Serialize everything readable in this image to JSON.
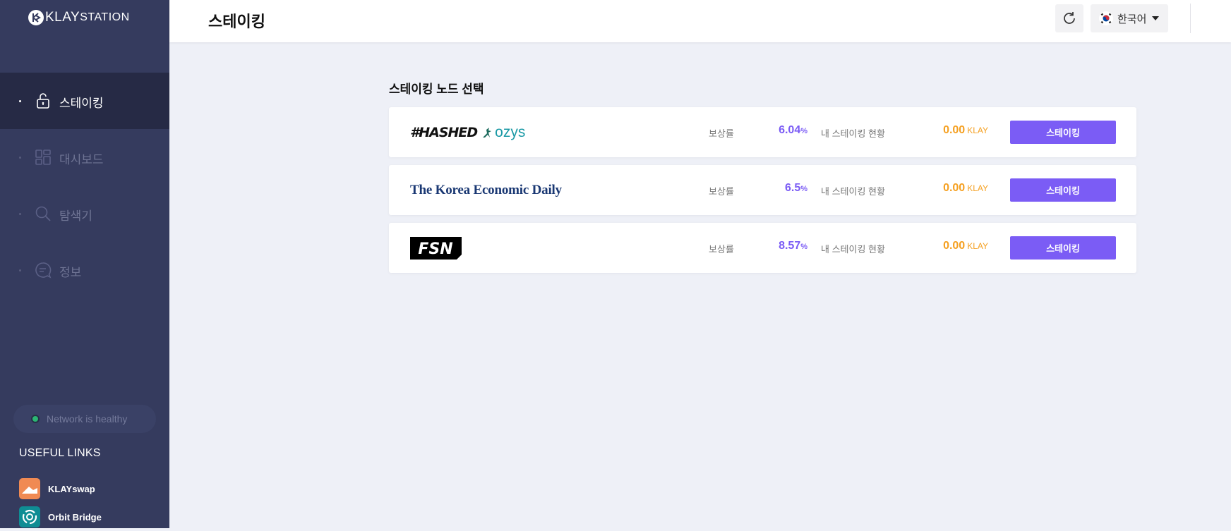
{
  "app": {
    "logo_text_klay": "KLAY",
    "logo_text_station": "STATION"
  },
  "sidebar": {
    "items": [
      {
        "label": "스테이킹",
        "icon": "lock-icon",
        "active": true
      },
      {
        "label": "대시보드",
        "icon": "dashboard-icon",
        "active": false
      },
      {
        "label": "탐색기",
        "icon": "search-icon",
        "active": false
      },
      {
        "label": "정보",
        "icon": "chat-info-icon",
        "active": false
      }
    ],
    "network_status": "Network is healthy",
    "useful_links_title": "USEFUL LINKS",
    "links": [
      {
        "label": "KLAYswap",
        "icon": "klayswap-icon"
      },
      {
        "label": "Orbit Bridge",
        "icon": "orbit-bridge-icon"
      }
    ]
  },
  "header": {
    "title": "스테이킹",
    "language": "한국어"
  },
  "main": {
    "section_title": "스테이킹 노드 선택",
    "nodes": [
      {
        "name_primary": "#HASHED",
        "name_secondary": "ozys",
        "reward_label": "보상률",
        "rate": "6.04",
        "rate_unit": "%",
        "my_label": "내 스테이킹 현황",
        "amount": "0.00",
        "unit": "KLAY",
        "button": "스테이킹"
      },
      {
        "name_primary": "The Korea Economic Daily",
        "reward_label": "보상률",
        "rate": "6.5",
        "rate_unit": "%",
        "my_label": "내 스테이킹 현황",
        "amount": "0.00",
        "unit": "KLAY",
        "button": "스테이킹"
      },
      {
        "name_primary": "FSN",
        "reward_label": "보상률",
        "rate": "8.57",
        "rate_unit": "%",
        "my_label": "내 스테이킹 현황",
        "amount": "0.00",
        "unit": "KLAY",
        "button": "스테이킹"
      }
    ]
  },
  "colors": {
    "sidebar_bg": "#353b5e",
    "sidebar_active_bg": "#262a45",
    "accent_purple": "#7b5cf5",
    "amount_orange": "#f5a021",
    "health_green": "#2bb673"
  }
}
